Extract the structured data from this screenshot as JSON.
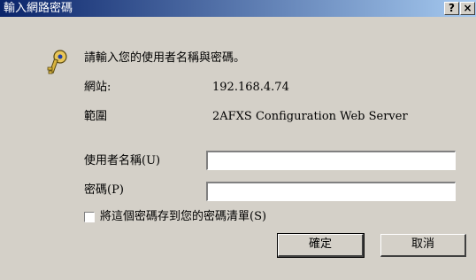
{
  "window": {
    "title": "輸入網路密碼",
    "help_label": "?",
    "close_label": "×"
  },
  "dialog": {
    "prompt": "請輸入您的使用者名稱與密碼。",
    "site_label": "網站:",
    "site_value": "192.168.4.74",
    "realm_label": "範圍",
    "realm_value": "2AFXS Configuration Web Server",
    "username_label": "使用者名稱(U)",
    "username_value": "",
    "password_label": "密碼(P)",
    "password_value": "",
    "save_password_label": "將這個密碼存到您的密碼清單(S)",
    "save_password_checked": false,
    "ok_label": "確定",
    "cancel_label": "取消",
    "icon": "key-icon"
  }
}
